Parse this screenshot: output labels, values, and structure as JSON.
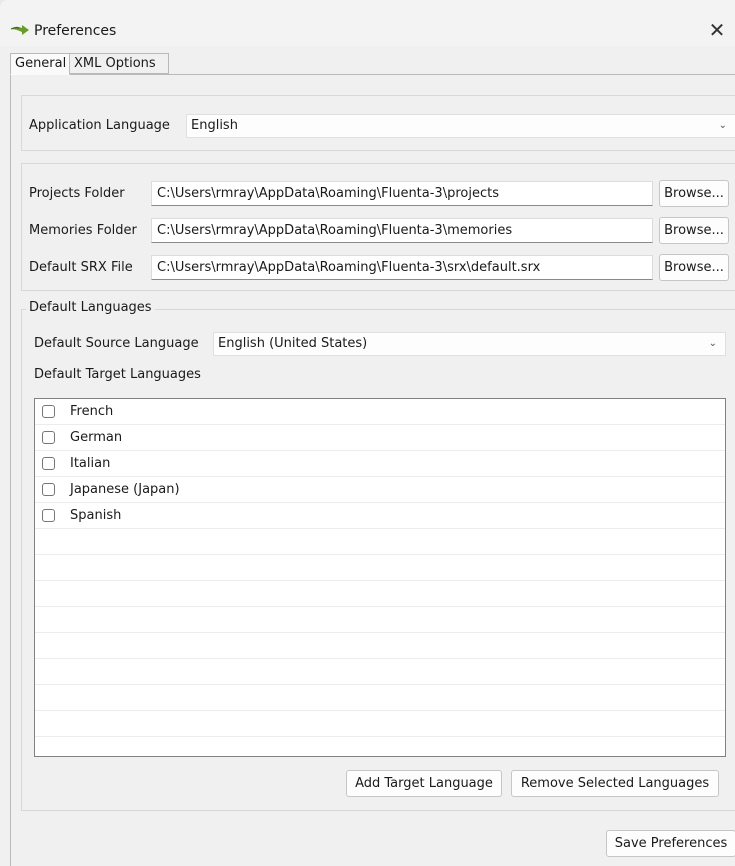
{
  "window": {
    "title": "Preferences",
    "close_glyph": "✕",
    "app_icon": "fluenta-arrow-icon"
  },
  "tabs": [
    {
      "label": "General",
      "active": true
    },
    {
      "label": "XML Options",
      "active": false
    }
  ],
  "general": {
    "app_language": {
      "label": "Application Language",
      "value": "English"
    },
    "projects_folder": {
      "label": "Projects Folder",
      "value": "C:\\Users\\rmray\\AppData\\Roaming\\Fluenta-3\\projects",
      "browse": "Browse..."
    },
    "memories_folder": {
      "label": "Memories Folder",
      "value": "C:\\Users\\rmray\\AppData\\Roaming\\Fluenta-3\\memories",
      "browse": "Browse..."
    },
    "default_srx": {
      "label": "Default SRX File",
      "value": "C:\\Users\\rmray\\AppData\\Roaming\\Fluenta-3\\srx\\default.srx",
      "browse": "Browse..."
    }
  },
  "default_languages": {
    "legend": "Default Languages",
    "source": {
      "label": "Default Source Language",
      "value": "English (United States)"
    },
    "targets_label": "Default Target Languages",
    "targets": [
      {
        "label": "French",
        "checked": false
      },
      {
        "label": "German",
        "checked": false
      },
      {
        "label": "Italian",
        "checked": false
      },
      {
        "label": "Japanese (Japan)",
        "checked": false
      },
      {
        "label": "Spanish",
        "checked": false
      }
    ],
    "add_button": "Add Target Language",
    "remove_button": "Remove Selected Languages"
  },
  "save_button": "Save Preferences",
  "colors": {
    "icon_green": "#6a9a2a",
    "accent_border": "#828282"
  }
}
